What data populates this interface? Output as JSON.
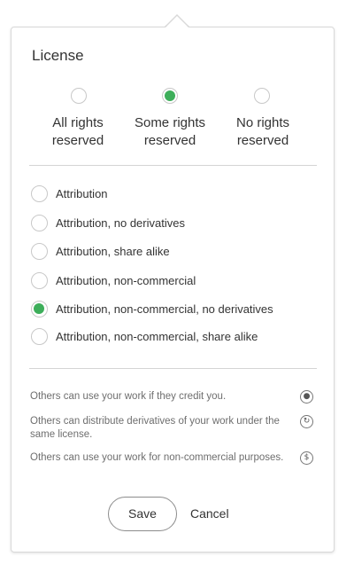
{
  "license": {
    "title": "License",
    "levels": [
      {
        "line1": "All rights",
        "line2": "reserved",
        "selected": false
      },
      {
        "line1": "Some rights",
        "line2": "reserved",
        "selected": true
      },
      {
        "line1": "No rights",
        "line2": "reserved",
        "selected": false
      }
    ],
    "options": [
      {
        "label": "Attribution",
        "selected": false
      },
      {
        "label": "Attribution, no derivatives",
        "selected": false
      },
      {
        "label": "Attribution, share alike",
        "selected": false
      },
      {
        "label": "Attribution, non-commercial",
        "selected": false
      },
      {
        "label": "Attribution, non-commercial, no derivatives",
        "selected": true
      },
      {
        "label": "Attribution, non-commercial, share alike",
        "selected": false
      }
    ],
    "descriptions": [
      {
        "text": "Others can use your work if they credit you.",
        "icon": "attribution-icon"
      },
      {
        "text": "Others can distribute derivatives of your work under the same license.",
        "icon": "share-alike-icon"
      },
      {
        "text": "Others can use your work for non-commercial purposes.",
        "icon": "non-commercial-icon"
      }
    ],
    "actions": {
      "save_label": "Save",
      "cancel_label": "Cancel"
    }
  },
  "colors": {
    "accent": "#3dae5a",
    "divider": "#d4d4d4",
    "muted_text": "#6e6e6e"
  }
}
